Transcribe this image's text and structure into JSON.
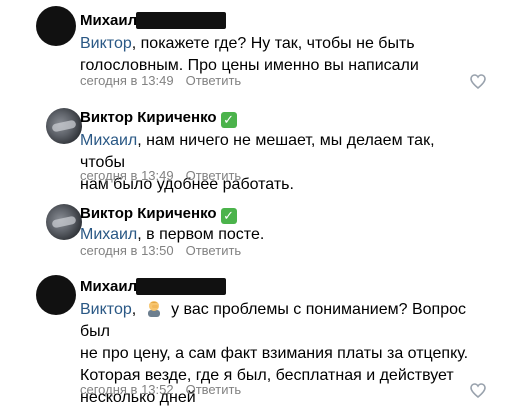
{
  "comments": [
    {
      "author": "Михаил",
      "mention": "Виктор",
      "text_line1_rest": ", покажете где? Ну так, чтобы не быть",
      "text_rest": "голословным. Про цены именно вы написали",
      "time": "сегодня в 13:49",
      "reply": "Ответить"
    },
    {
      "author": "Виктор Кириченко",
      "verified": "✓",
      "mention": "Михаил",
      "text_line1_rest": ", нам ничего не мешает, мы делаем так, чтобы",
      "text_rest": "нам было удобнее работать.",
      "time": "сегодня в 13:49",
      "reply": "Ответить"
    },
    {
      "author": "Виктор Кириченко",
      "verified": "✓",
      "mention": "Михаил",
      "text_line1_rest": ", в первом посте.",
      "time": "сегодня в 13:50",
      "reply": "Ответить"
    },
    {
      "author": "Михаил",
      "mention": "Виктор",
      "text_line1_rest": "у вас проблемы с пониманием? Вопрос был",
      "text_line2": "не про цену, а сам факт взимания платы за отцепку.",
      "text_line3": "Которая везде, где я был, бесплатная и действует",
      "text_line4": "несколько дней",
      "time": "сегодня в 13:52",
      "reply": "Ответить"
    }
  ],
  "icons": {
    "like": "heart-outline-icon",
    "verified": "verified-check-icon",
    "emoji": "man-facepalming-emoji"
  },
  "colors": {
    "mention": "#2a5885",
    "meta": "#828282",
    "verified": "#4bb34b"
  }
}
